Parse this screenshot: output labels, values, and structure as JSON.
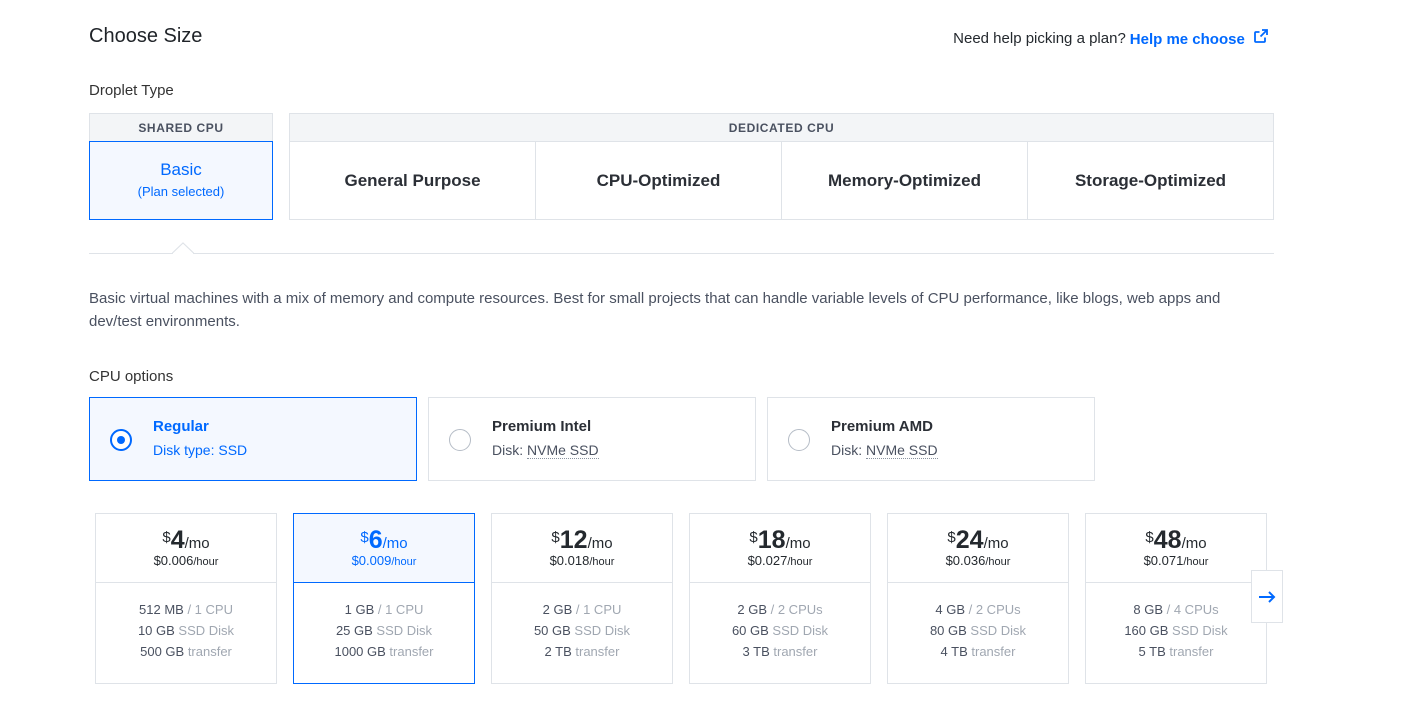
{
  "header": {
    "title": "Choose Size",
    "help_text": "Need help picking a plan?",
    "help_link": "Help me choose"
  },
  "droplet_type": {
    "label": "Droplet Type",
    "shared_header": "SHARED CPU",
    "basic_label": "Basic",
    "basic_sub": "(Plan selected)",
    "dedicated_header": "DEDICATED CPU",
    "dedicated_items": [
      "General Purpose",
      "CPU-Optimized",
      "Memory-Optimized",
      "Storage-Optimized"
    ]
  },
  "description": "Basic virtual machines with a mix of memory and compute resources. Best for small projects that can handle variable levels of CPU performance, like blogs, web apps and dev/test environments.",
  "cpu_options": {
    "label": "CPU options",
    "items": [
      {
        "name": "Regular",
        "disk_prefix": "Disk type: ",
        "disk": "SSD",
        "selected": true
      },
      {
        "name": "Premium Intel",
        "disk_prefix": "Disk: ",
        "disk": "NVMe SSD",
        "selected": false
      },
      {
        "name": "Premium AMD",
        "disk_prefix": "Disk: ",
        "disk": "NVMe SSD",
        "selected": false
      }
    ]
  },
  "plans": [
    {
      "currency": "$",
      "amount": "4",
      "per": "/mo",
      "hourly": "$0.006",
      "hour_unit": "/hour",
      "mem": "512 MB",
      "cpu": " / 1 CPU",
      "disk": "10 GB",
      "disk_type": " SSD Disk",
      "transfer": "500 GB",
      "transfer_label": " transfer",
      "selected": false
    },
    {
      "currency": "$",
      "amount": "6",
      "per": "/mo",
      "hourly": "$0.009",
      "hour_unit": "/hour",
      "mem": "1 GB",
      "cpu": " / 1 CPU",
      "disk": "25 GB",
      "disk_type": " SSD Disk",
      "transfer": "1000 GB",
      "transfer_label": " transfer",
      "selected": true
    },
    {
      "currency": "$",
      "amount": "12",
      "per": "/mo",
      "hourly": "$0.018",
      "hour_unit": "/hour",
      "mem": "2 GB",
      "cpu": " / 1 CPU",
      "disk": "50 GB",
      "disk_type": " SSD Disk",
      "transfer": "2 TB",
      "transfer_label": " transfer",
      "selected": false
    },
    {
      "currency": "$",
      "amount": "18",
      "per": "/mo",
      "hourly": "$0.027",
      "hour_unit": "/hour",
      "mem": "2 GB",
      "cpu": " / 2 CPUs",
      "disk": "60 GB",
      "disk_type": " SSD Disk",
      "transfer": "3 TB",
      "transfer_label": " transfer",
      "selected": false
    },
    {
      "currency": "$",
      "amount": "24",
      "per": "/mo",
      "hourly": "$0.036",
      "hour_unit": "/hour",
      "mem": "4 GB",
      "cpu": " / 2 CPUs",
      "disk": "80 GB",
      "disk_type": " SSD Disk",
      "transfer": "4 TB",
      "transfer_label": " transfer",
      "selected": false
    },
    {
      "currency": "$",
      "amount": "48",
      "per": "/mo",
      "hourly": "$0.071",
      "hour_unit": "/hour",
      "mem": "8 GB",
      "cpu": " / 4 CPUs",
      "disk": "160 GB",
      "disk_type": " SSD Disk",
      "transfer": "5 TB",
      "transfer_label": " transfer",
      "selected": false
    }
  ],
  "colors": {
    "accent": "#0069ff",
    "border": "#dfe3e8"
  },
  "icons": {
    "external": "external-link-icon",
    "next": "arrow-right-icon"
  }
}
